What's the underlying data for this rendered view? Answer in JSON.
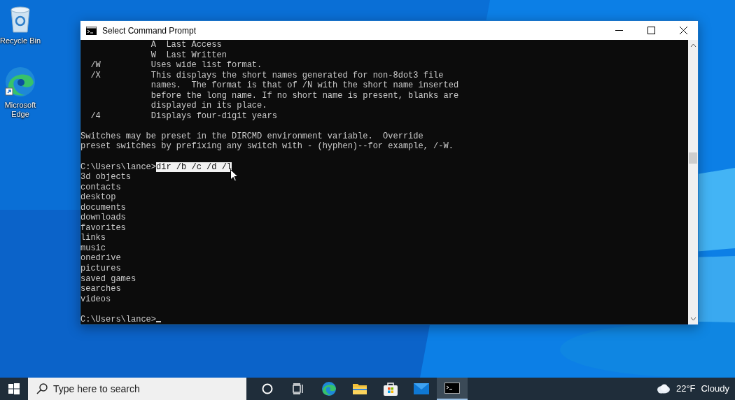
{
  "desktop": {
    "icons": [
      {
        "kind": "recycle",
        "label": "Recycle Bin"
      },
      {
        "kind": "edge",
        "label": "Microsoft Edge"
      }
    ]
  },
  "window": {
    "title": "Select Command Prompt",
    "console": [
      {
        "kind": "text",
        "text": "              A  Last Access"
      },
      {
        "kind": "text",
        "text": "              W  Last Written"
      },
      {
        "kind": "text",
        "text": "  /W          Uses wide list format."
      },
      {
        "kind": "text",
        "text": "  /X          This displays the short names generated for non-8dot3 file"
      },
      {
        "kind": "text",
        "text": "              names.  The format is that of /N with the short name inserted"
      },
      {
        "kind": "text",
        "text": "              before the long name. If no short name is present, blanks are"
      },
      {
        "kind": "text",
        "text": "              displayed in its place."
      },
      {
        "kind": "text",
        "text": "  /4          Displays four-digit years"
      },
      {
        "kind": "blank"
      },
      {
        "kind": "text",
        "text": "Switches may be preset in the DIRCMD environment variable.  Override"
      },
      {
        "kind": "text",
        "text": "preset switches by prefixing any switch with - (hyphen)--for example, /-W."
      },
      {
        "kind": "blank"
      },
      {
        "kind": "prompt",
        "prompt": "C:\\Users\\lance>",
        "command": "dir /b /c /d /l",
        "selected": true
      },
      {
        "kind": "text",
        "text": "3d objects"
      },
      {
        "kind": "text",
        "text": "contacts"
      },
      {
        "kind": "text",
        "text": "desktop"
      },
      {
        "kind": "text",
        "text": "documents"
      },
      {
        "kind": "text",
        "text": "downloads"
      },
      {
        "kind": "text",
        "text": "favorites"
      },
      {
        "kind": "text",
        "text": "links"
      },
      {
        "kind": "text",
        "text": "music"
      },
      {
        "kind": "text",
        "text": "onedrive"
      },
      {
        "kind": "text",
        "text": "pictures"
      },
      {
        "kind": "text",
        "text": "saved games"
      },
      {
        "kind": "text",
        "text": "searches"
      },
      {
        "kind": "text",
        "text": "videos"
      },
      {
        "kind": "blank"
      },
      {
        "kind": "prompt",
        "prompt": "C:\\Users\\lance>",
        "cursor": true
      }
    ]
  },
  "taskbar": {
    "search": {
      "placeholder": "Type here to search"
    },
    "apps": [
      {
        "kind": "cortana",
        "selected": false
      },
      {
        "kind": "taskview",
        "selected": false
      },
      {
        "kind": "edge",
        "selected": false
      },
      {
        "kind": "explorer",
        "selected": false
      },
      {
        "kind": "store",
        "selected": false
      },
      {
        "kind": "mail",
        "selected": false
      },
      {
        "kind": "cmd",
        "selected": true
      }
    ],
    "weather": {
      "temperature": "22°F",
      "condition": "Cloudy"
    }
  }
}
